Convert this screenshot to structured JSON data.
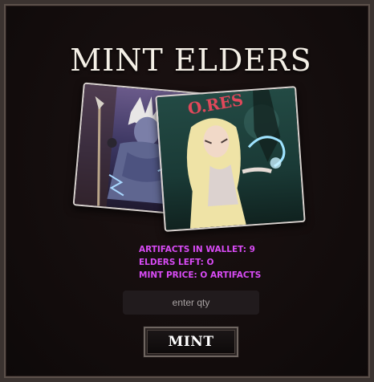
{
  "header": {
    "title": "MINT ELDERS"
  },
  "artwork": {
    "left_card": "warrior-character-art",
    "right_card": "elf-sorceress-character-art",
    "right_card_banner_text": "O.RES"
  },
  "stats": {
    "artifacts_in_wallet": "ARTIFACTS IN WALLET: 9",
    "elders_left": "ELDERS LEFT: O",
    "mint_price": "MINT PRICE: O ARTIFACTS"
  },
  "form": {
    "qty_placeholder": "enter qty",
    "mint_label": "MINT"
  },
  "colors": {
    "background": "#120c0c",
    "stats_text": "#d84bf5",
    "title_text": "#f4efe6"
  }
}
